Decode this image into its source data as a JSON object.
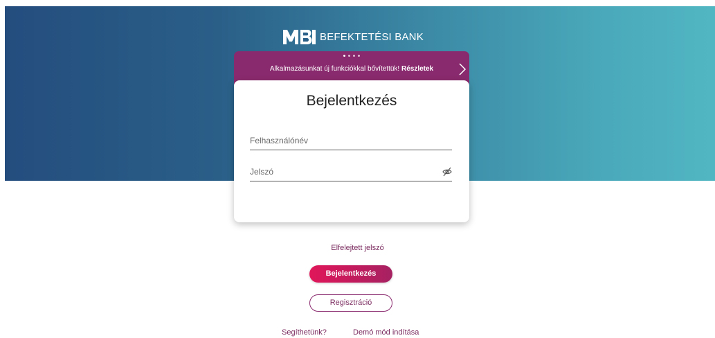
{
  "brand": {
    "logo_mark": "MBH",
    "name": "BEFEKTETÉSI BANK"
  },
  "banner": {
    "dots": 4,
    "active_dot": 1,
    "text": "Alkalmazásunkat új funkciókkal bővítettük!",
    "link_label": "Részletek",
    "arrow_icon": "chevron-right-icon",
    "color": "#8a2a6e"
  },
  "login": {
    "title": "Bejelentkezés",
    "username": {
      "placeholder": "Felhasználónév",
      "value": ""
    },
    "password": {
      "placeholder": "Jelszó",
      "value": "",
      "toggle_icon": "eye-off-icon"
    }
  },
  "actions": {
    "forgot_password": "Elfelejtett jelszó",
    "login_button": "Bejelentkezés",
    "register_button": "Regisztráció"
  },
  "footer": {
    "help": "Segíthetünk?",
    "demo": "Demó mód indítása"
  },
  "colors": {
    "accent": "#c11b5d",
    "link": "#7a2a5e",
    "hero_start": "#244d7e",
    "hero_end": "#52b6c2"
  }
}
